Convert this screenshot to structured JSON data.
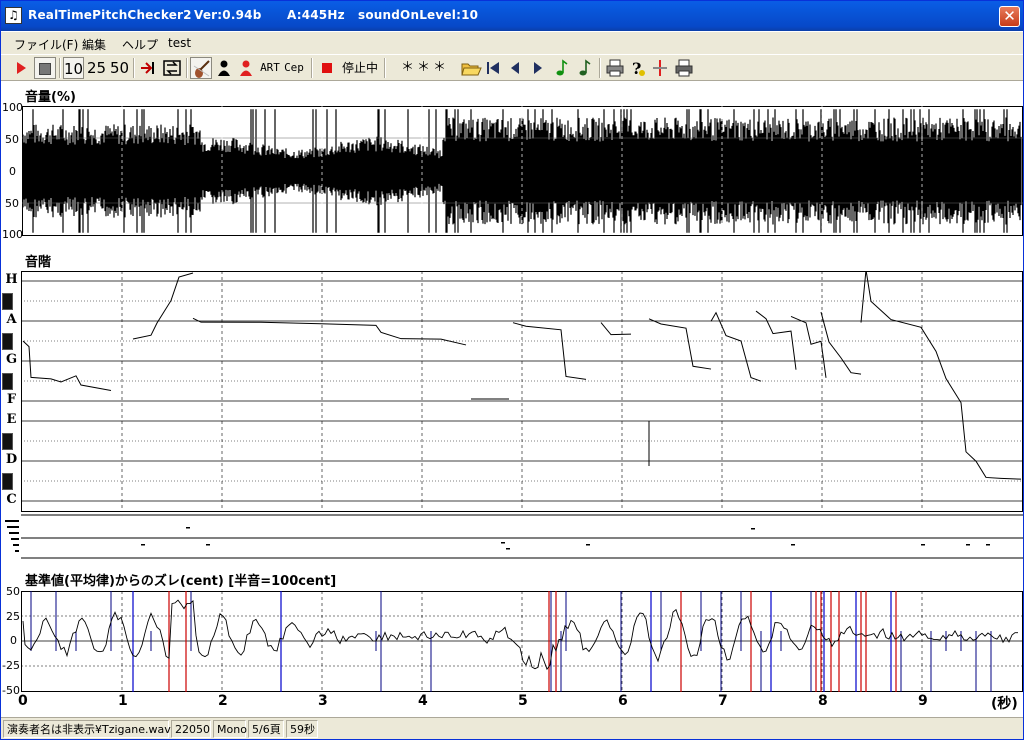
{
  "window": {
    "title": "RealTimePitchChecker2",
    "version": "Ver:0.94b",
    "a_freq": "A:445Hz",
    "sound_on_level": "soundOnLevel:10",
    "close_glyph": "✕",
    "app_icon": "♫"
  },
  "menu": {
    "items": [
      "ファイル(F)",
      "編集",
      "ヘルプ",
      "test"
    ]
  },
  "toolbar": {
    "speed_options": [
      "10",
      "25",
      "50"
    ],
    "art_label": "ART",
    "cep_label": "Cep",
    "state_label": "停止中",
    "note_display": "＊＊＊",
    "icons": [
      "play-icon",
      "stop-icon",
      "goto-end-icon",
      "loop-icon",
      "violin-icon",
      "singer-icon",
      "singer-red-icon",
      "art-icon",
      "cep-icon",
      "record-icon",
      "open-folder-icon",
      "first-page-icon",
      "prev-page-icon",
      "next-page-icon",
      "note-green-icon",
      "note-dark-icon",
      "print-icon",
      "help-icon",
      "marker-icon",
      "print2-icon"
    ]
  },
  "volume_panel": {
    "title": "音量(%)",
    "y_labels": [
      "100",
      "50",
      "0",
      "50",
      "100"
    ]
  },
  "pitch_panel": {
    "title": "音階",
    "notes": [
      "H",
      "A",
      "G",
      "F",
      "E",
      "D",
      "C"
    ]
  },
  "cent_panel": {
    "title": "基準値(平均律)からのズレ(cent) [半音=100cent]",
    "y_labels": [
      "50",
      "25",
      "0",
      "-25",
      "-50"
    ]
  },
  "time_axis": {
    "ticks": [
      "0",
      "1",
      "2",
      "3",
      "4",
      "5",
      "6",
      "7",
      "8",
      "9"
    ],
    "unit": "(秒)"
  },
  "statusbar": {
    "file": "演奏者名は非表示¥Tzigane.wav",
    "sample_rate": "22050",
    "channels": "Mono",
    "page": "5/6頁",
    "duration": "59秒"
  },
  "colors": {
    "title_bar": "#0854d7",
    "chrome": "#ece9d8",
    "waveform": "#000000",
    "cent_positive_marker": "#cc0000",
    "cent_negative_marker": "#0000cc"
  }
}
